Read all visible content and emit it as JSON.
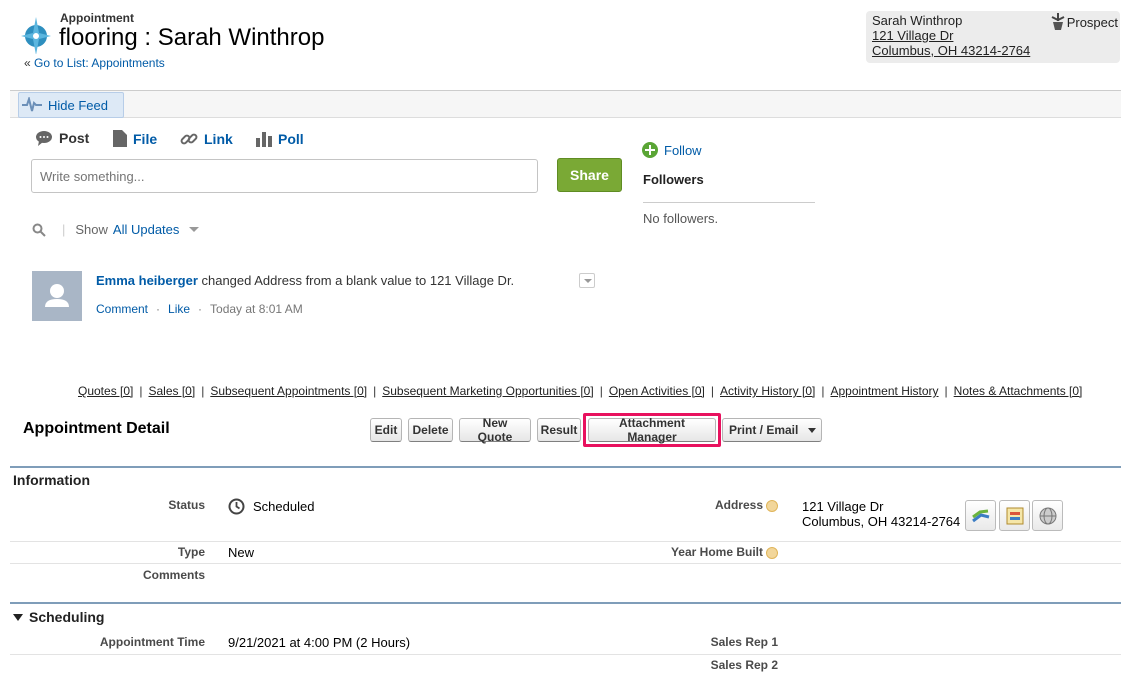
{
  "header": {
    "object_type": "Appointment",
    "record_title": "flooring : Sarah Winthrop",
    "back_arrow": "«",
    "back_link": "Go to List: Appointments"
  },
  "contact_card": {
    "name": "Sarah Winthrop",
    "address_line1": "121 Village Dr",
    "address_line2": "Columbus, OH 43214-2764",
    "status": "Prospect"
  },
  "feed": {
    "hide_feed_label": "Hide Feed",
    "tabs": [
      {
        "label": "Post",
        "icon": "post-bubble-icon"
      },
      {
        "label": "File",
        "icon": "file-icon"
      },
      {
        "label": "Link",
        "icon": "link-icon"
      },
      {
        "label": "Poll",
        "icon": "poll-icon"
      }
    ],
    "write_placeholder": "Write something...",
    "share_label": "Share",
    "follow_label": "Follow",
    "followers_heading": "Followers",
    "no_followers": "No followers.",
    "filter": {
      "show_label": "Show",
      "selected": "All Updates"
    },
    "item": {
      "actor": "Emma heiberger",
      "text": " changed Address from a blank value to 121 Village Dr.",
      "comment": "Comment",
      "like": "Like",
      "dot": "·",
      "time": "Today at 8:01 AM"
    }
  },
  "related_links": [
    "Quotes [0]",
    "Sales [0]",
    "Subsequent Appointments [0]",
    "Subsequent Marketing Opportunities [0]",
    "Open Activities [0]",
    "Activity History [0]",
    "Appointment History",
    "Notes & Attachments [0]"
  ],
  "related_sep": "|",
  "detail": {
    "title": "Appointment Detail",
    "buttons": {
      "edit": "Edit",
      "delete": "Delete",
      "new_quote": "New Quote",
      "result": "Result",
      "attachment_manager": "Attachment Manager",
      "print_email": "Print / Email"
    }
  },
  "information": {
    "heading": "Information",
    "status_label": "Status",
    "status_value": "Scheduled",
    "type_label": "Type",
    "type_value": "New",
    "comments_label": "Comments",
    "address_label": "Address",
    "address_line1": "121 Village Dr",
    "address_line2": "Columbus, OH 43214-2764",
    "year_built_label": "Year Home Built"
  },
  "scheduling": {
    "heading": "Scheduling",
    "appt_time_label": "Appointment Time",
    "appt_time_value": "9/21/2021 at 4:00 PM (2 Hours)",
    "sales_rep1_label": "Sales Rep 1",
    "sales_rep2_label": "Sales Rep 2"
  },
  "colors": {
    "link": "#015ba7",
    "share_green": "#7aa935",
    "highlight_pink": "#e8115e",
    "section_rule": "#7f9db9"
  }
}
